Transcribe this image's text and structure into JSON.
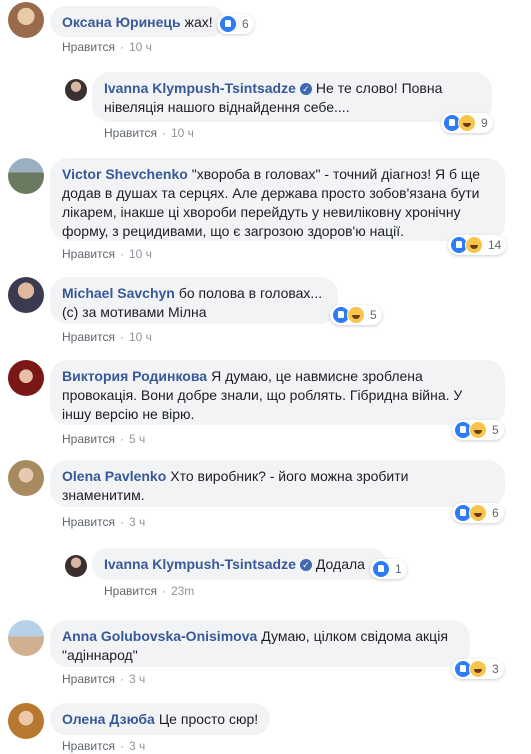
{
  "like_label": "Нравится",
  "comments": [
    {
      "author": "Оксана Юринець",
      "text": "жах!",
      "time": "10 ч",
      "reactions": [
        "like"
      ],
      "count": "6",
      "verified": false
    },
    {
      "author": "Ivanna Klympush-Tsintsadze",
      "text": "Не те слово! Повна нівеляція нашого віднайдення себе....",
      "time": "10 ч",
      "reactions": [
        "like",
        "haha"
      ],
      "count": "9",
      "verified": true
    },
    {
      "author": "Victor Shevchenko",
      "text": "\"хвороба в головах\" - точний діагноз! Я б ще додав в душах та серцях. Але держава просто зобов'язана бути лікарем, інакше ці хвороби перейдуть у невиліковну хронічну форму, з рецидивами, що є загрозою здоров'ю нації.",
      "time": "10 ч",
      "reactions": [
        "like",
        "haha"
      ],
      "count": "14",
      "verified": false
    },
    {
      "author": "Michael Savchyn",
      "text": "бо полова в головах... (с) за мотивами Мілна",
      "time": "10 ч",
      "reactions": [
        "like",
        "haha"
      ],
      "count": "5",
      "verified": false
    },
    {
      "author": "Виктория Родинкова",
      "text": "Я думаю, це навмисне зроблена провокація. Вони добре знали, що роблять. Гібридна війна. У іншу версію не вірю.",
      "time": "5 ч",
      "reactions": [
        "like",
        "haha"
      ],
      "count": "5",
      "verified": false
    },
    {
      "author": "Olena Pavlenko",
      "text": "Хто виробник? - його можна зробити знаменитим.",
      "time": "3 ч",
      "reactions": [
        "like",
        "haha"
      ],
      "count": "6",
      "verified": false
    },
    {
      "author": "Ivanna Klympush-Tsintsadze",
      "text": "Додала",
      "time": "23m",
      "reactions": [
        "like"
      ],
      "count": "1",
      "verified": true
    },
    {
      "author": "Anna Golubovska-Onisimova",
      "text": "Думаю, цілком свідома акція \"адіннарод\"",
      "time": "3 ч",
      "reactions": [
        "like",
        "haha"
      ],
      "count": "3",
      "verified": false
    },
    {
      "author": "Олена Дзюба",
      "text": "Це просто сюр!",
      "time": "3 ч",
      "reactions": [],
      "count": "",
      "verified": false
    }
  ],
  "colors": {
    "link": "#385898",
    "bubble": "#f2f3f5",
    "meta": "#90949c",
    "like": "#2e7bf6",
    "haha": "#f7c54b"
  }
}
